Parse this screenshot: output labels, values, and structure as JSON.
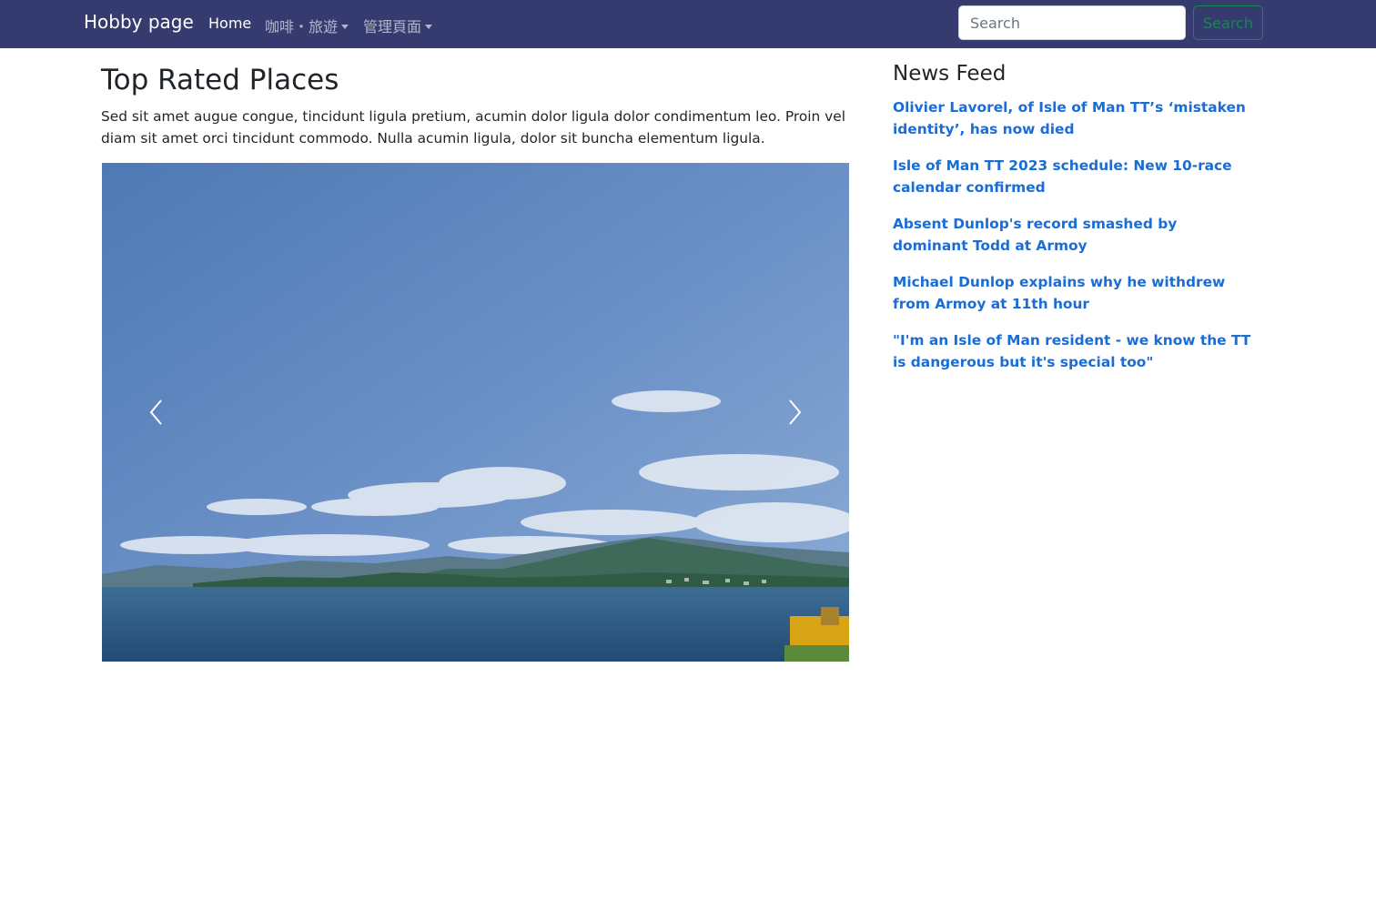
{
  "navbar": {
    "brand": "Hobby page",
    "links": [
      {
        "label": "Home"
      },
      {
        "label": "咖啡・旅遊"
      },
      {
        "label": "管理頁面"
      }
    ],
    "search": {
      "placeholder": "Search",
      "button_label": "Search"
    }
  },
  "main": {
    "title": "Top Rated Places",
    "intro": "Sed sit amet augue congue, tincidunt ligula pretium, acumin dolor ligula dolor condimentum leo. Proin vel diam sit amet orci tincidunt commodo. Nulla acumin ligula, dolor sit buncha elementum ligula.",
    "carousel": {
      "prev_icon": "chevron-left-icon",
      "next_icon": "chevron-right-icon"
    }
  },
  "news": {
    "title": "News Feed",
    "items": [
      {
        "label": "Olivier Lavorel, of Isle of Man TT’s ‘mistaken identity’, has now died"
      },
      {
        "label": "Isle of Man TT 2023 schedule: New 10-race calendar confirmed"
      },
      {
        "label": "Absent Dunlop's record smashed by dominant Todd at Armoy"
      },
      {
        "label": "Michael Dunlop explains why he withdrew from Armoy at 11th hour"
      },
      {
        "label": "\"I'm an Isle of Man resident - we know the TT is dangerous but it's special too\""
      }
    ]
  },
  "colors": {
    "navbar_bg": "#353a6f",
    "link": "#1a6dd6",
    "search_button": "#198754"
  }
}
